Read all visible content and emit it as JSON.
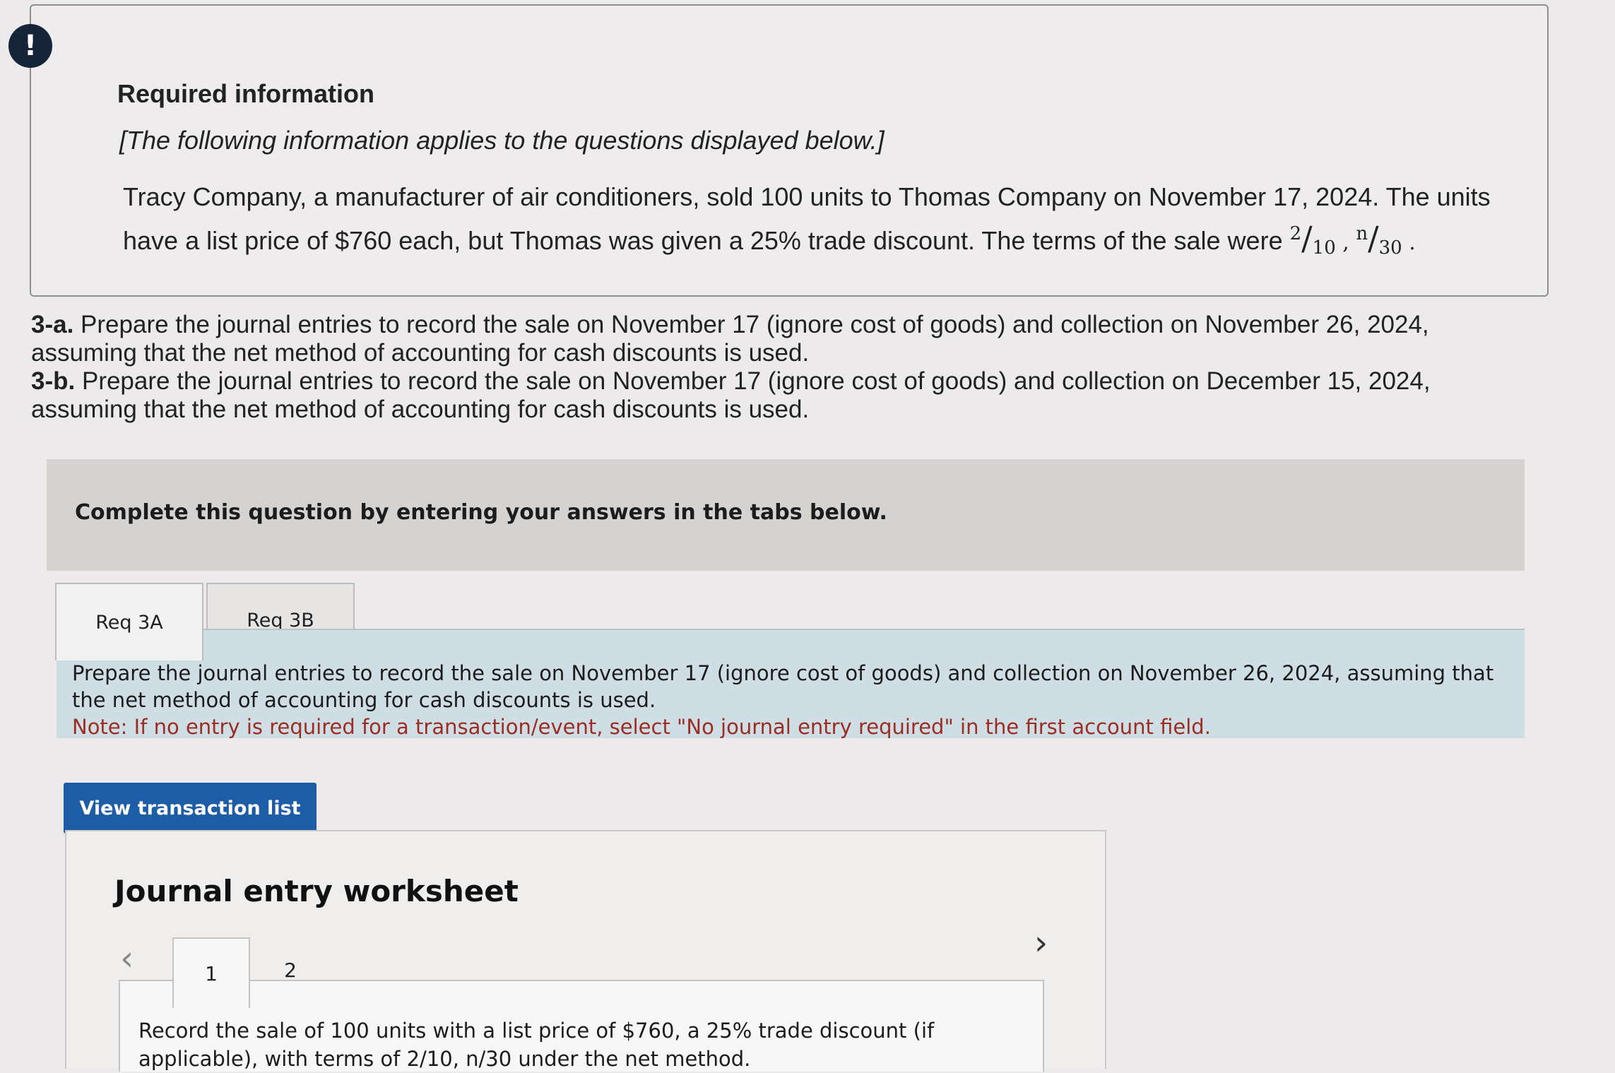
{
  "info": {
    "title": "Required information",
    "subtitle": "[The following information applies to the questions displayed below.]",
    "body": "Tracy Company, a manufacturer of air conditioners, sold 100 units to Thomas Company on November 17, 2024. The units have a list price of $760 each, but Thomas was given a 25% trade discount. The terms of the sale were",
    "terms": {
      "a_num": "2",
      "a_den": "10",
      "sep": ",",
      "b_num": "n",
      "b_den": "30",
      "end": "."
    }
  },
  "question": {
    "a_label": "3-a.",
    "a_text": "Prepare the journal entries to record the sale on November 17 (ignore cost of goods) and collection on November 26, 2024, assuming that the net method of accounting for cash discounts is used.",
    "b_label": "3-b.",
    "b_text": "Prepare the journal entries to record the sale on November 17 (ignore cost of goods) and collection on December 15, 2024, assuming that the net method of accounting for cash discounts is used."
  },
  "banner": {
    "text": "Complete this question by entering your answers in the tabs below."
  },
  "tabs": [
    {
      "label": "Req 3A"
    },
    {
      "label": "Req 3B"
    }
  ],
  "panel": {
    "instruction": "Prepare the journal entries to record the sale on November 17 (ignore cost of goods) and collection on November 26, 2024, assuming that the net method of accounting for cash discounts is used.",
    "note": "Note: If no entry is required for a transaction/event, select \"No journal entry required\" in the first account field."
  },
  "buttons": {
    "view_transactions": "View transaction list"
  },
  "worksheet": {
    "title": "Journal entry worksheet",
    "prev_icon": "chevron-left-icon",
    "next_icon": "chevron-right-icon",
    "steps": [
      "1",
      "2"
    ],
    "instruction": "Record the sale of 100 units with a list price of $760, a 25% trade discount (if applicable), with terms of 2/10, n/30 under the net method."
  },
  "colors": {
    "button_blue": "#1d5da8",
    "note_red": "#9b2d23",
    "panel_blue": "#cfdde4",
    "alert_navy": "#16243a"
  }
}
